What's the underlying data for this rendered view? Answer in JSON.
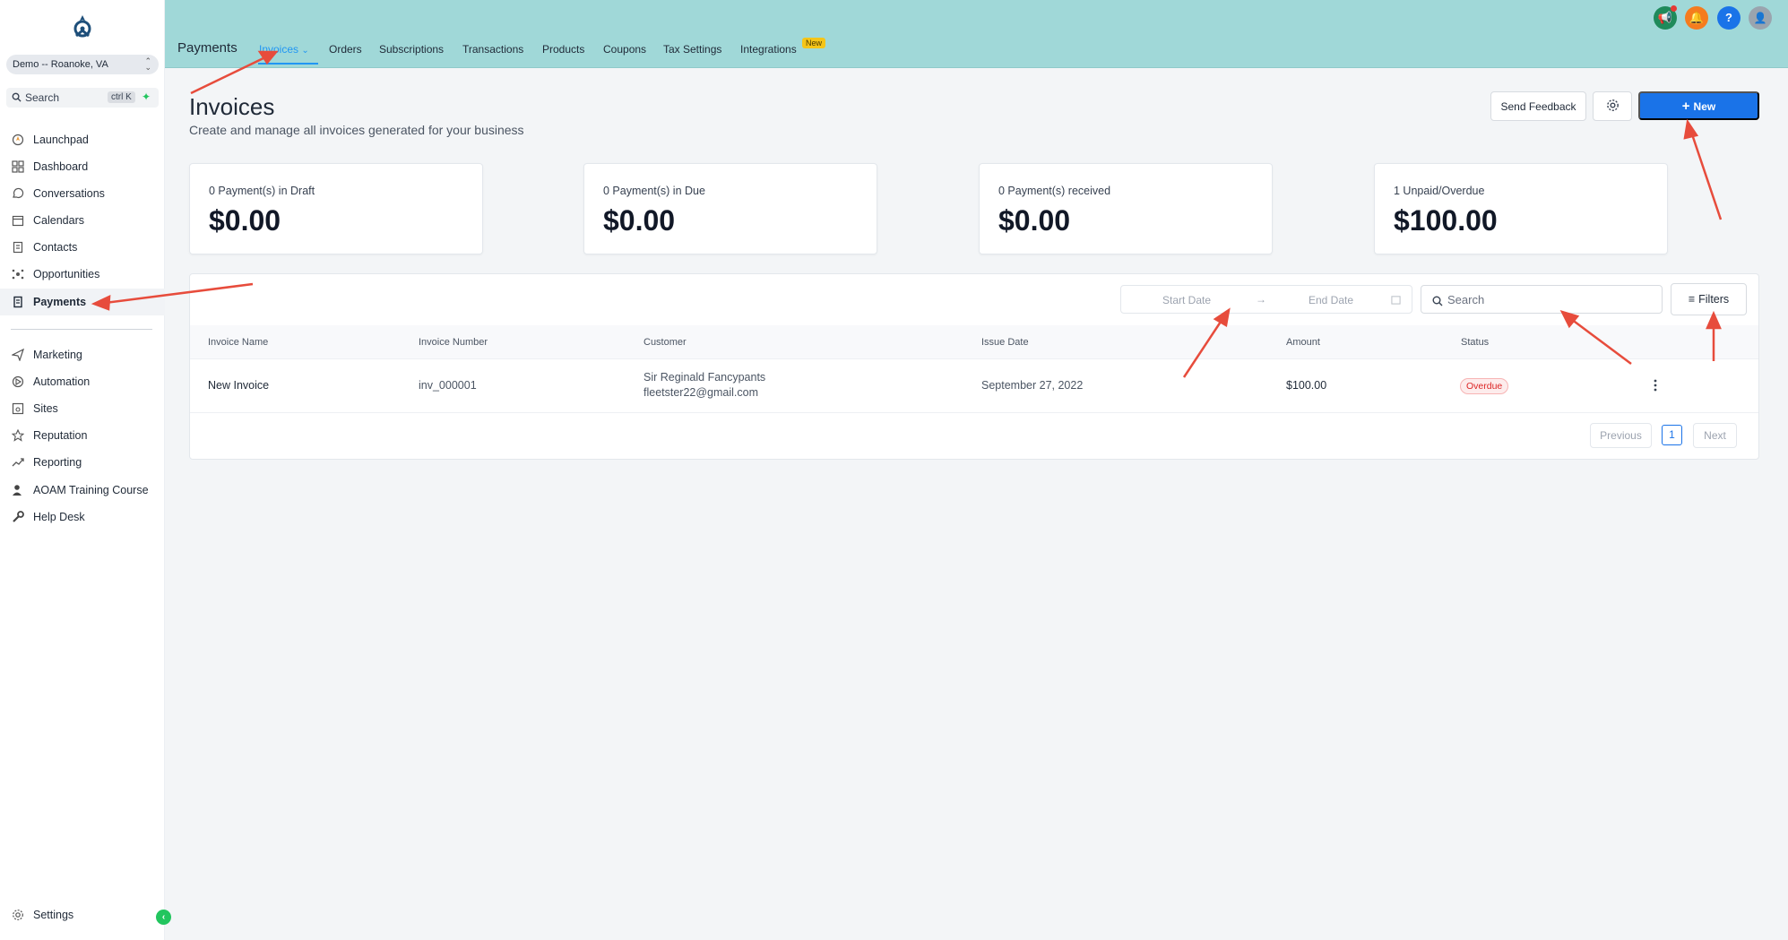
{
  "sidebar": {
    "location": "Demo -- Roanoke, VA",
    "search_label": "Search",
    "search_shortcut": "ctrl K",
    "items": [
      {
        "label": "Launchpad",
        "icon": "rocket-icon"
      },
      {
        "label": "Dashboard",
        "icon": "grid-icon"
      },
      {
        "label": "Conversations",
        "icon": "chat-bubble-icon"
      },
      {
        "label": "Calendars",
        "icon": "calendar-icon"
      },
      {
        "label": "Contacts",
        "icon": "contacts-book-icon"
      },
      {
        "label": "Opportunities",
        "icon": "network-icon"
      },
      {
        "label": "Payments",
        "icon": "receipt-icon"
      },
      {
        "label": "Marketing",
        "icon": "send-icon"
      },
      {
        "label": "Automation",
        "icon": "automation-icon"
      },
      {
        "label": "Sites",
        "icon": "sites-icon"
      },
      {
        "label": "Reputation",
        "icon": "star-icon"
      },
      {
        "label": "Reporting",
        "icon": "trend-icon"
      },
      {
        "label": "AOAM Training Course",
        "icon": "user-course-icon"
      },
      {
        "label": "Help Desk",
        "icon": "wrench-icon"
      }
    ],
    "settings_label": "Settings"
  },
  "topbar": {
    "section_title": "Payments",
    "tabs": [
      {
        "label": "Invoices"
      },
      {
        "label": "Orders"
      },
      {
        "label": "Subscriptions"
      },
      {
        "label": "Transactions"
      },
      {
        "label": "Products"
      },
      {
        "label": "Coupons"
      },
      {
        "label": "Tax Settings"
      },
      {
        "label": "Integrations"
      }
    ],
    "new_badge": "New"
  },
  "page": {
    "title": "Invoices",
    "subtitle": "Create and manage all invoices generated for your business",
    "send_feedback": "Send Feedback",
    "new_button": "New"
  },
  "summary_cards": [
    {
      "label": "0 Payment(s) in Draft",
      "value": "$0.00"
    },
    {
      "label": "0 Payment(s) in Due",
      "value": "$0.00"
    },
    {
      "label": "0 Payment(s) received",
      "value": "$0.00"
    },
    {
      "label": "1 Unpaid/Overdue",
      "value": "$100.00"
    }
  ],
  "filters": {
    "start_date_placeholder": "Start Date",
    "end_date_placeholder": "End Date",
    "search_placeholder": "Search",
    "filters_label": "Filters"
  },
  "table": {
    "columns": [
      "Invoice Name",
      "Invoice Number",
      "Customer",
      "Issue Date",
      "Amount",
      "Status"
    ],
    "rows": [
      {
        "invoice_name": "New Invoice",
        "invoice_number": "inv_000001",
        "customer_name": "Sir Reginald Fancypants",
        "customer_email": "fleetster22@gmail.com",
        "issue_date": "September 27, 2022",
        "amount": "$100.00",
        "status": "Overdue"
      }
    ]
  },
  "pagination": {
    "previous": "Previous",
    "page": "1",
    "next": "Next"
  },
  "colors": {
    "topbar": "#a0d8d8",
    "primary": "#1a73e8",
    "active_tab": "#2196f3",
    "overdue": "#dc2626",
    "annotation_arrow": "#e74c3c"
  }
}
